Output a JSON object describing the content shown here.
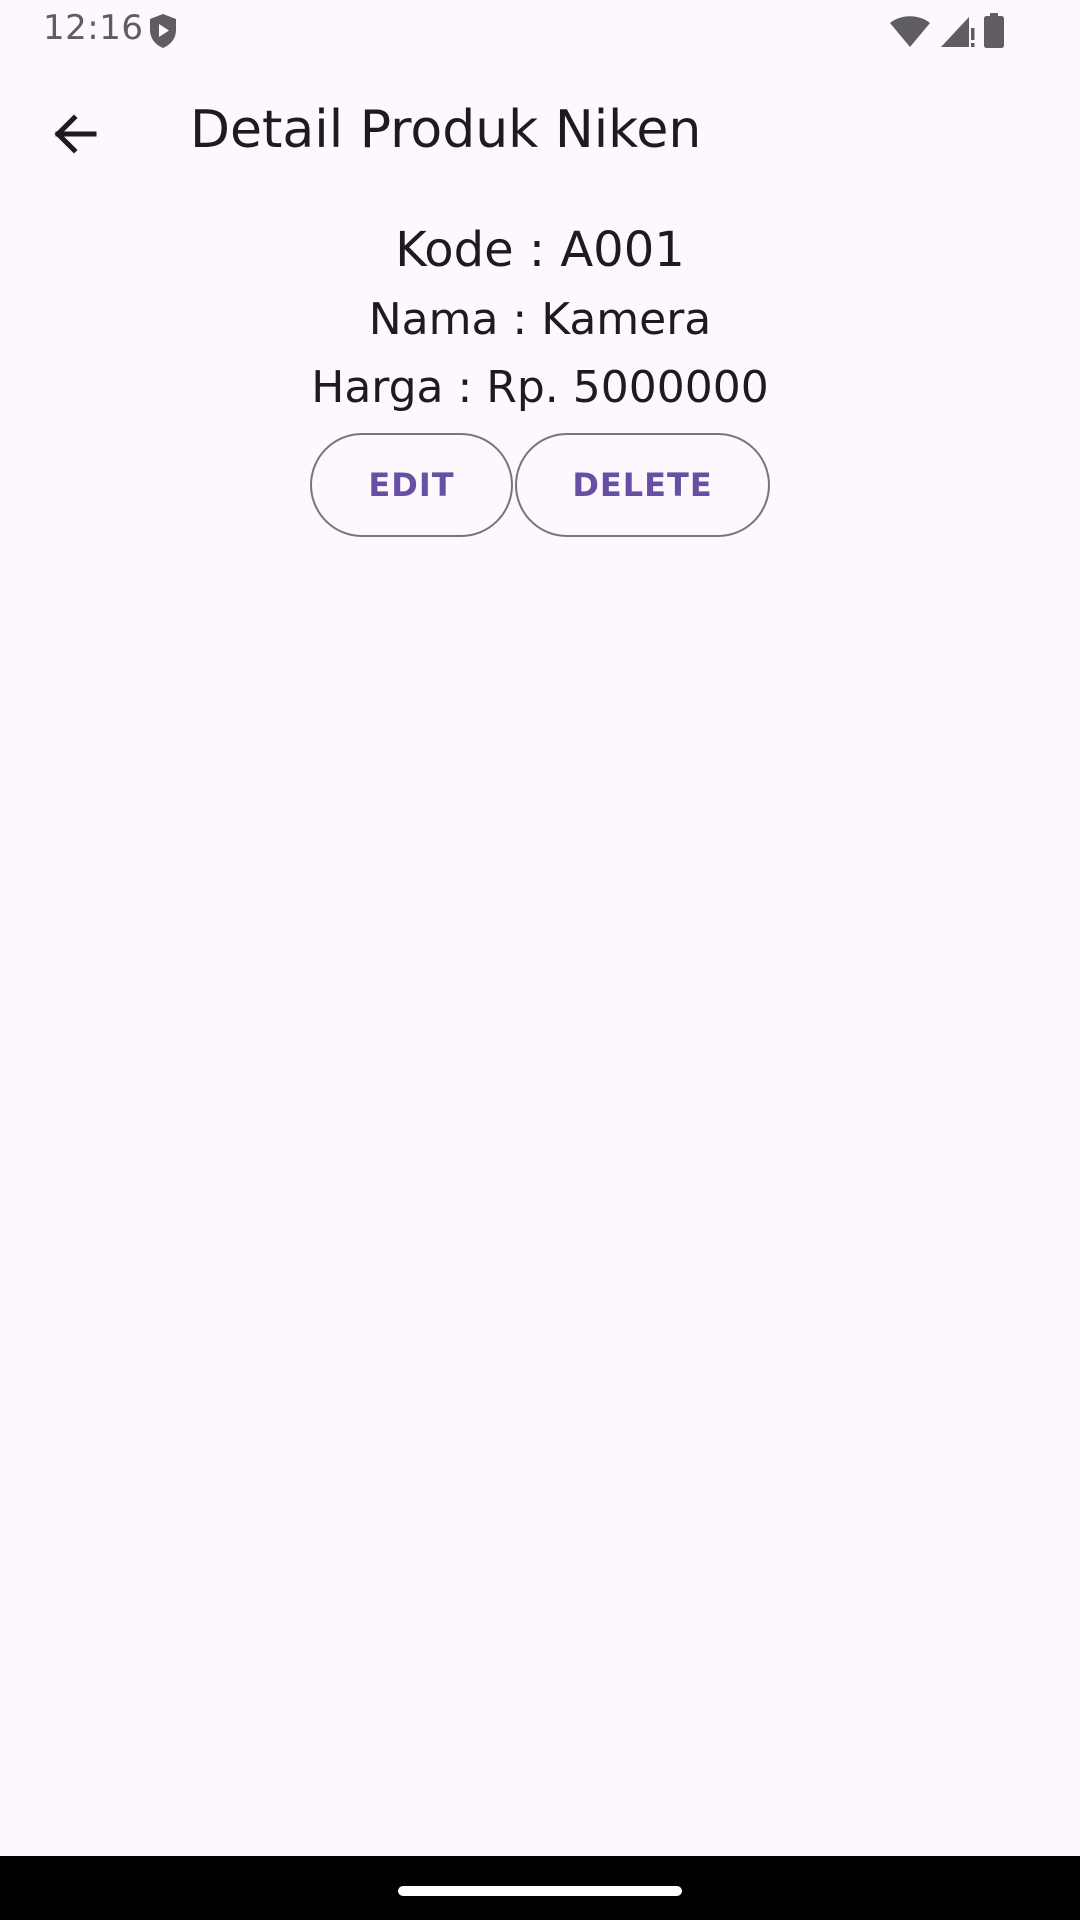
{
  "status_bar": {
    "time": "12:16",
    "left_icon": "shield-play-icon",
    "right_icons": [
      "wifi-icon",
      "signal-icon",
      "battery-icon"
    ]
  },
  "app_bar": {
    "back_icon": "arrow-back-icon",
    "title": "Detail Produk Niken"
  },
  "product": {
    "kode": "Kode : A001",
    "nama": "Nama : Kamera",
    "harga": "Harga : Rp. 5000000"
  },
  "actions": {
    "edit_label": "EDIT",
    "delete_label": "DELETE"
  },
  "colors": {
    "background": "#fdf7fe",
    "primary": "#6750a4",
    "outline": "#79747e",
    "on_surface": "#1d1b20"
  }
}
